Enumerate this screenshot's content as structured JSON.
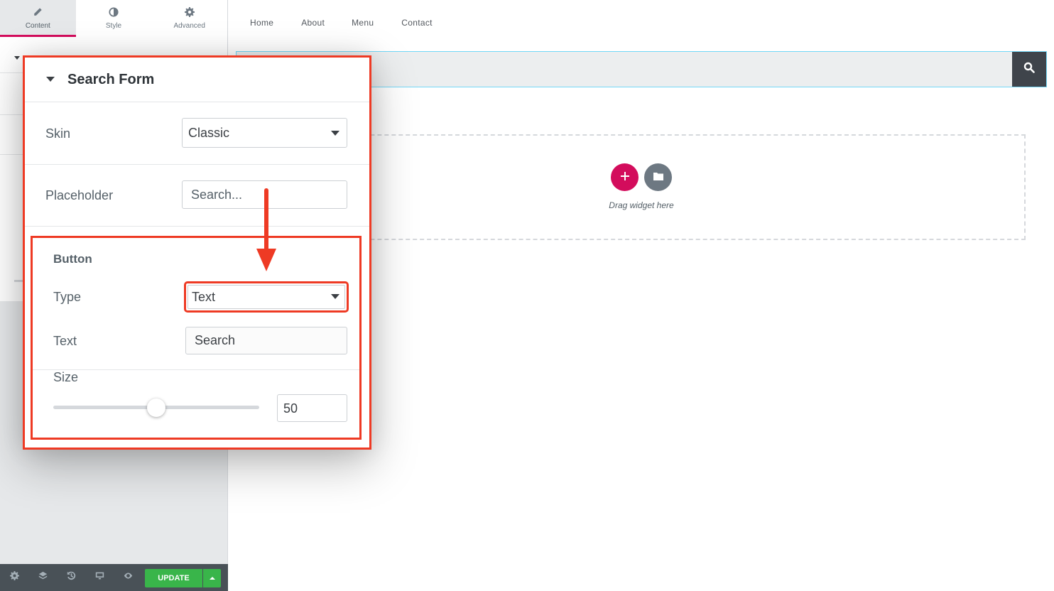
{
  "panel": {
    "tabs": [
      {
        "label": "Content",
        "icon": "pencil-icon",
        "active": true
      },
      {
        "label": "Style",
        "icon": "contrast-icon",
        "active": false
      },
      {
        "label": "Advanced",
        "icon": "gear-icon",
        "active": false
      }
    ],
    "footer": {
      "tools": [
        "settings-icon",
        "layers-icon",
        "history-icon",
        "responsive-icon",
        "preview-eye-icon"
      ],
      "update_label": "UPDATE"
    }
  },
  "preview": {
    "nav": [
      "Home",
      "About",
      "Menu",
      "Contact"
    ],
    "search_button_icon": "search-icon",
    "drop_zone_text": "Drag widget here"
  },
  "callout": {
    "section_title": "Search Form",
    "skin": {
      "label": "Skin",
      "value": "Classic"
    },
    "placeholder": {
      "label": "Placeholder",
      "value": "Search..."
    },
    "button": {
      "heading": "Button",
      "type": {
        "label": "Type",
        "value": "Text"
      },
      "text": {
        "label": "Text",
        "value": "Search"
      },
      "size": {
        "label": "Size",
        "value": "50",
        "slider_fraction": 0.5
      }
    }
  },
  "colors": {
    "accent": "#d30c5c",
    "highlight": "#ee3a24",
    "update_green": "#39b54a",
    "footer_bg": "#495157"
  }
}
